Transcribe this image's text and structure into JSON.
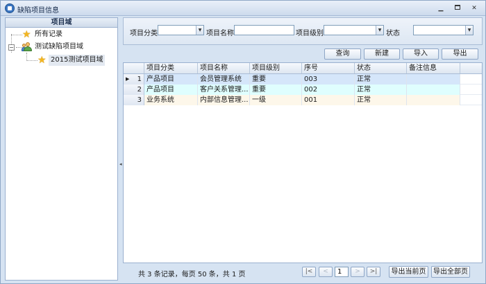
{
  "window": {
    "title": "缺陷项目信息",
    "controls": {
      "minimize": "▁",
      "close": "✕"
    }
  },
  "left_panel": {
    "header": "项目域",
    "tree": {
      "root_label": "所有记录",
      "group_label": "测试缺陷项目域",
      "child_label": "2015测试项目域",
      "expander_symbol": "−"
    }
  },
  "splitter": {
    "grip": "◂"
  },
  "filter": {
    "category_label": "项目分类",
    "category_value": "",
    "name_label": "项目名称",
    "name_value": "",
    "level_label": "项目级别",
    "level_value": "",
    "status_label": "状态",
    "status_value": "",
    "dropdown_arrow": "▼"
  },
  "toolbar": {
    "query": "查询",
    "create": "新建",
    "import": "导入",
    "export": "导出"
  },
  "grid": {
    "columns": [
      "项目分类",
      "项目名称",
      "项目级别",
      "序号",
      "状态",
      "备注信息"
    ],
    "current_row_marker": "▶",
    "rows": [
      {
        "num": "1",
        "category": "产品项目",
        "name": "会员管理系统",
        "level": "重要",
        "seq": "003",
        "status": "正常",
        "remark": ""
      },
      {
        "num": "2",
        "category": "产品项目",
        "name": "客户关系管理...",
        "level": "重要",
        "seq": "002",
        "status": "正常",
        "remark": ""
      },
      {
        "num": "3",
        "category": "业务系统",
        "name": "内部信息管理...",
        "level": "一级",
        "seq": "001",
        "status": "正常",
        "remark": ""
      }
    ]
  },
  "pager": {
    "info": "共 3 条记录，每页 50 条，共 1 页",
    "first": "|<",
    "prev": "<",
    "page": "1",
    "next": ">",
    "last": ">|",
    "export_current": "导出当前页",
    "export_all": "导出全部页"
  },
  "colors": {
    "row_selected": "#d5e6fa",
    "row_alt": "#dffefe",
    "row_third": "#fdf7ea"
  }
}
